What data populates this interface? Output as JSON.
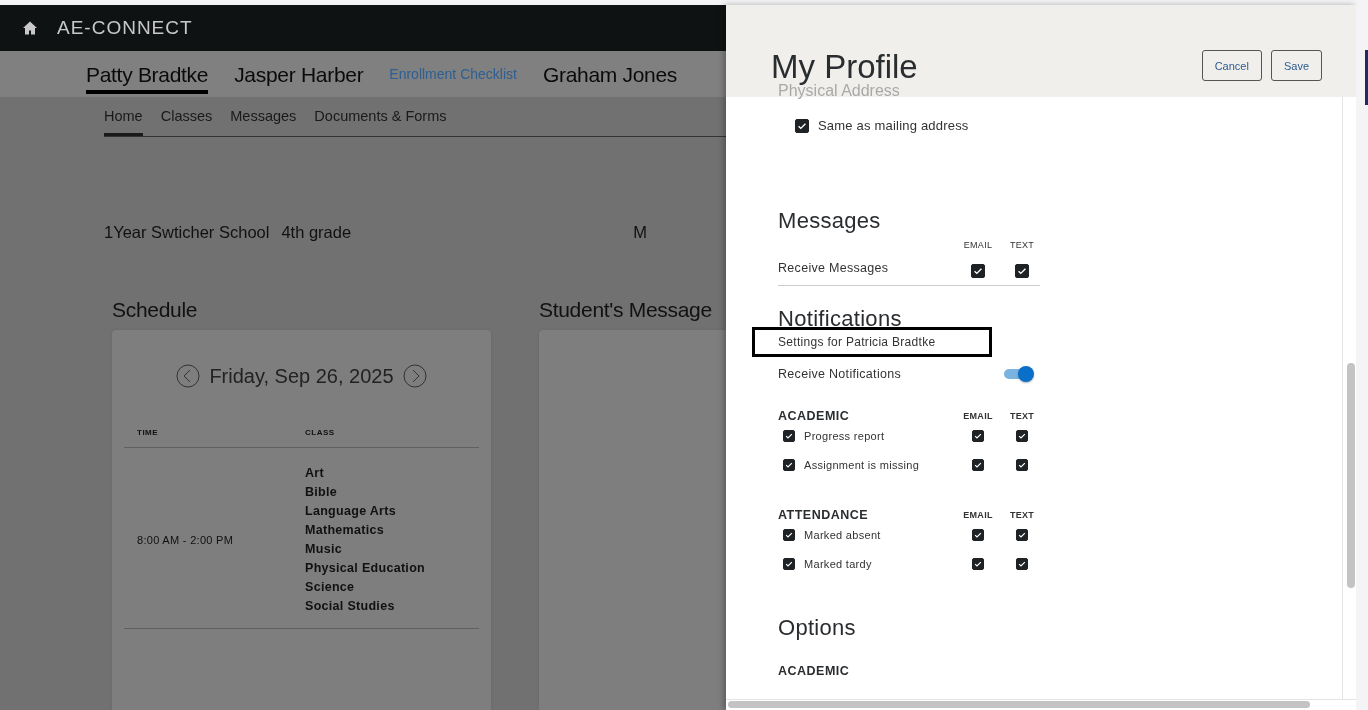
{
  "app": {
    "title": "AE-CONNECT"
  },
  "students": [
    {
      "kind": "student",
      "label": "Patty Bradtke",
      "selected": true
    },
    {
      "kind": "student",
      "label": "Jasper Harber",
      "selected": false
    },
    {
      "kind": "link",
      "label": "Enrollment Checklist"
    },
    {
      "kind": "student",
      "label": "Graham Jones",
      "selected": false
    }
  ],
  "nav": [
    {
      "label": "Home",
      "selected": true
    },
    {
      "label": "Classes",
      "selected": false
    },
    {
      "label": "Messages",
      "selected": false
    },
    {
      "label": "Documents & Forms",
      "selected": false
    }
  ],
  "school": {
    "name": "1Year Swticher School",
    "grade": "4th grade",
    "column_3": "M"
  },
  "schedule": {
    "title": "Schedule",
    "date": "Friday, Sep 26, 2025",
    "columns": [
      "TIME",
      "CLASS"
    ],
    "rows": [
      {
        "time": "8:00 AM - 2:00 PM",
        "classes": [
          "Art",
          "Bible",
          "Language Arts",
          "Mathematics",
          "Music",
          "Physical Education",
          "Science",
          "Social Studies"
        ]
      }
    ]
  },
  "messages_panel": {
    "title": "Student's Message"
  },
  "profile": {
    "title": "My Profile",
    "buttons": [
      "Cancel",
      "Save"
    ],
    "faded_section": "Physical Address",
    "same_as_mailing": {
      "label": "Same as mailing address",
      "checked": true
    },
    "messages": {
      "title": "Messages",
      "columns": [
        "EMAIL",
        "TEXT"
      ],
      "rows": [
        {
          "label": "Receive Messages",
          "email": true,
          "text": true
        }
      ]
    },
    "notifications": {
      "title": "Notifications",
      "settings_for": "Settings for Patricia Bradtke",
      "receive": {
        "label": "Receive Notifications",
        "on": true
      },
      "groups": [
        {
          "title": "ACADEMIC",
          "columns": [
            "EMAIL",
            "TEXT"
          ],
          "items": [
            {
              "label": "Progress report",
              "checked": true,
              "email": true,
              "text": true
            },
            {
              "label": "Assignment is missing",
              "checked": true,
              "email": true,
              "text": true
            }
          ]
        },
        {
          "title": "ATTENDANCE",
          "columns": [
            "EMAIL",
            "TEXT"
          ],
          "items": [
            {
              "label": "Marked absent",
              "checked": true,
              "email": true,
              "text": true
            },
            {
              "label": "Marked tardy",
              "checked": true,
              "email": true,
              "text": true
            }
          ]
        }
      ]
    },
    "options": {
      "title": "Options",
      "groups": [
        {
          "title": "ACADEMIC"
        }
      ]
    }
  }
}
